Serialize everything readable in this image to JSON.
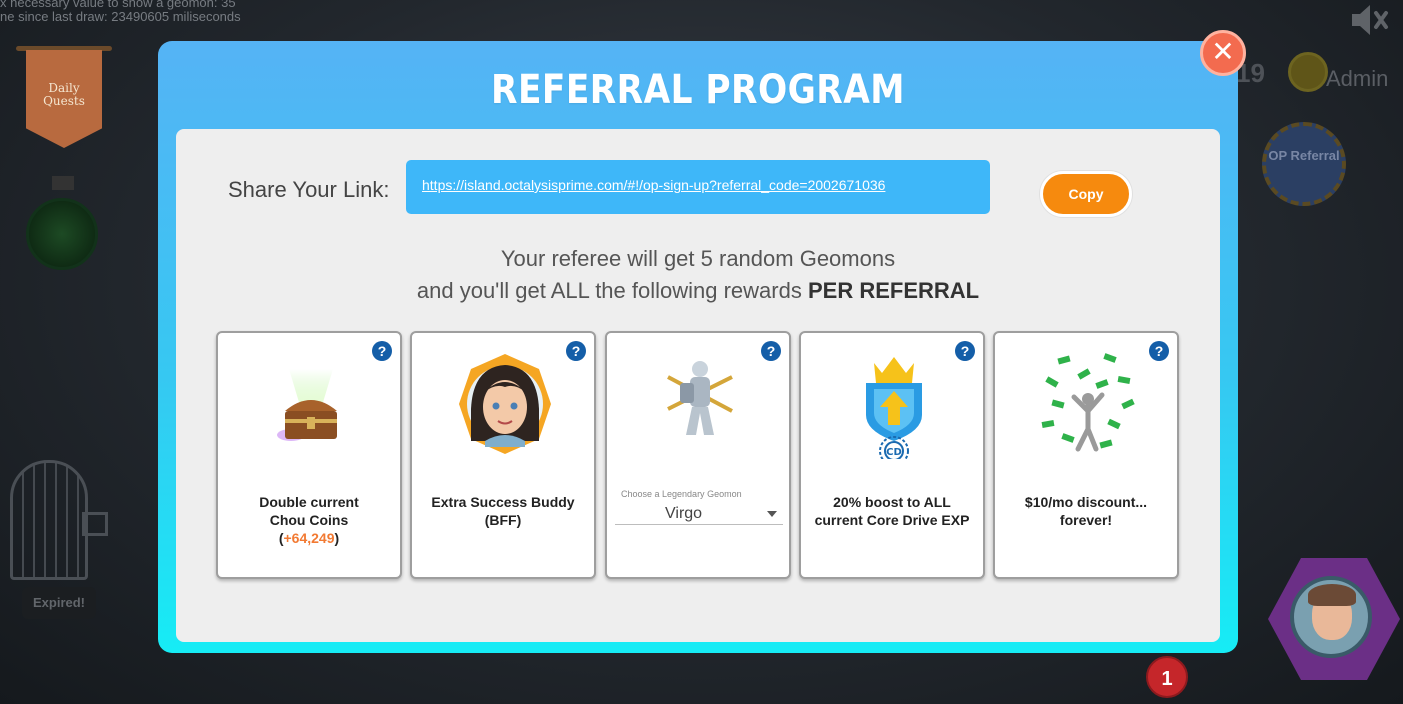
{
  "background": {
    "debug_lines": [
      "x necessary value to show a geomon: 35",
      "ne since last draw: 23490605 miliseconds"
    ],
    "daily_quests_label": "Daily Quests",
    "expired_label": "Expired!",
    "admin_label": "Admin",
    "admin_number": "19",
    "op_referral_label": "OP Referral",
    "notification_count": "1"
  },
  "modal": {
    "title": "REFERRAL PROGRAM",
    "close_icon": "close-icon",
    "share_label": "Share Your Link:",
    "referral_link": "https://island.octalysisprime.com/#!/op-sign-up?referral_code=2002671036",
    "copy_label": "Copy",
    "description_line1": "Your referee will get 5 random Geomons",
    "description_line2_prefix": "and you'll get ALL the following rewards",
    "description_line2_bold": "PER REFERRAL",
    "help_glyph": "?",
    "cards": [
      {
        "name": "chou-coins",
        "label_line1": "Double current",
        "label_line2": "Chou Coins",
        "amount": "+64,249"
      },
      {
        "name": "success-buddy",
        "label": "Extra Success Buddy (BFF)"
      },
      {
        "name": "legendary-geomon",
        "select_caption": "Choose a Legendary Geomon",
        "select_value": "Virgo"
      },
      {
        "name": "core-drive-boost",
        "label": "20% boost to ALL current Core Drive EXP",
        "badge": "CD"
      },
      {
        "name": "discount",
        "label": "$10/mo discount... forever!"
      }
    ]
  },
  "colors": {
    "modal_gradient_top": "#55b3f5",
    "modal_gradient_bottom": "#16ecf5",
    "link_box": "#3eb7f9",
    "copy_button": "#f68a0e",
    "coins_highlight": "#f27a33",
    "help_icon": "#145ea8",
    "close_button": "#f36b4f"
  }
}
